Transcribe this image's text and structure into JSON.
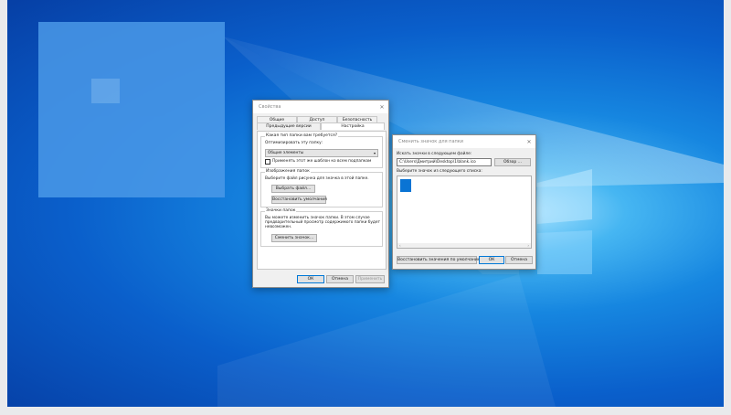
{
  "colors": {
    "accent": "#0078d7",
    "desktop": "#0a5fcb",
    "folder_icon": "#0a74d4"
  },
  "properties": {
    "title": "Свойства",
    "tabs_row1": [
      "Общие",
      "Доступ",
      "Безопасность"
    ],
    "tabs_row2": [
      "Предыдущие версии",
      "Настройка"
    ],
    "active_tab": "Настройка",
    "optimize_group": {
      "caption": "Какая тип папки вам требуется?",
      "optimize_label": "Оптимизировать эту папку:",
      "select_value": "Общие элементы",
      "apply_sub_label": "Применять этот же шаблон ко всем подпапкам"
    },
    "image_group": {
      "caption": "Изображения папок",
      "desc": "Выберите файл рисунка для значка в этой папке.",
      "choose_btn": "Выбрать файл...",
      "restore_btn": "Восстановить умолчания"
    },
    "icons_group": {
      "caption": "Значки папок",
      "desc1": "Вы можете изменить значок папки. В этом случае",
      "desc2": "предварительный просмотр содержимого папки будет",
      "desc3": "невозможен.",
      "change_btn": "Сменить значок..."
    },
    "ok": "ОК",
    "cancel": "Отмена",
    "apply": "Применить"
  },
  "change_icon": {
    "title": "Сменить значок для папки",
    "file_label": "Искать значки в следующем файле:",
    "file_value": "C:\\Users\\Дмитрий\\Desktop\\1\\blank.ico",
    "browse_btn": "Обзор ...",
    "list_label": "Выберите значок из следующего списка:",
    "restore_btn": "Восстановить значения по умолчанию",
    "ok": "ОК",
    "cancel": "Отмена"
  }
}
